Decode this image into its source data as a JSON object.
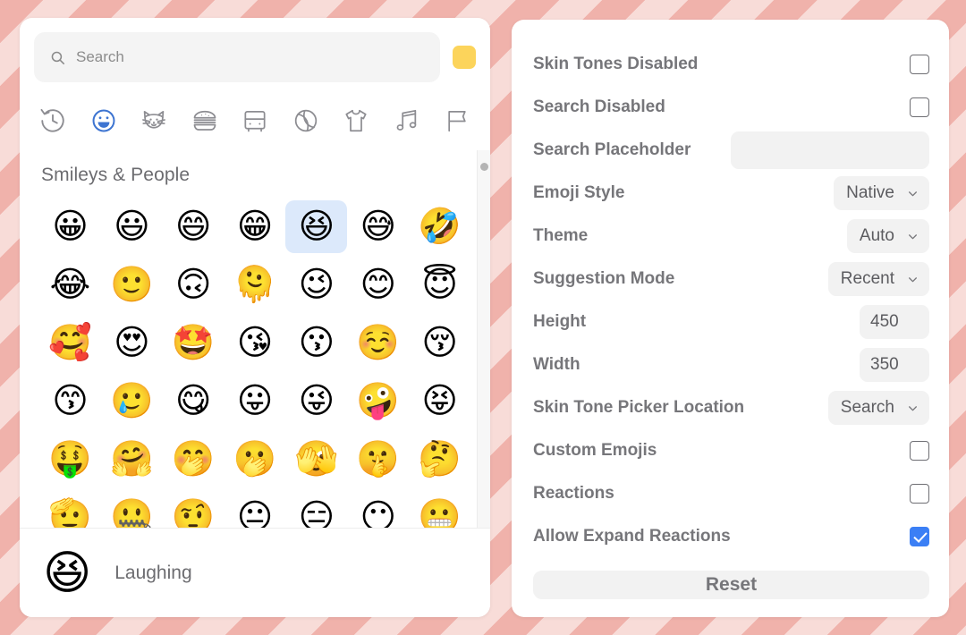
{
  "picker": {
    "search": {
      "placeholder": "Search",
      "value": "",
      "icon": "search-icon"
    },
    "skin_tone_swatch": {
      "color": "#fcd45b",
      "name": "skin-tone-swatch"
    },
    "categories": [
      {
        "id": "recent",
        "label": "Recently Used",
        "icon": "clock-icon",
        "active": false
      },
      {
        "id": "smileys",
        "label": "Smileys & People",
        "icon": "smiley-icon",
        "active": true
      },
      {
        "id": "animals",
        "label": "Animals & Nature",
        "icon": "cat-icon",
        "active": false
      },
      {
        "id": "food",
        "label": "Food & Drink",
        "icon": "burger-icon",
        "active": false
      },
      {
        "id": "travel",
        "label": "Travel & Places",
        "icon": "bus-icon",
        "active": false
      },
      {
        "id": "activities",
        "label": "Activities",
        "icon": "ball-icon",
        "active": false
      },
      {
        "id": "objects",
        "label": "Objects",
        "icon": "shirt-icon",
        "active": false
      },
      {
        "id": "symbols",
        "label": "Symbols",
        "icon": "music-note-icon",
        "active": false
      },
      {
        "id": "flags",
        "label": "Flags",
        "icon": "flag-icon",
        "active": false
      }
    ],
    "group_title": "Smileys & People",
    "emoji_rows": [
      [
        "😀",
        "😃",
        "😄",
        "😁",
        "😆",
        "😅",
        "🤣"
      ],
      [
        "😂",
        "🙂",
        "🙃",
        "🫠",
        "😉",
        "😊",
        "😇"
      ],
      [
        "🥰",
        "😍",
        "🤩",
        "😘",
        "😗",
        "☺️",
        "😚"
      ],
      [
        "😙",
        "🥲",
        "😋",
        "😛",
        "😜",
        "🤪",
        "😝"
      ],
      [
        "🤑",
        "🤗",
        "🤭",
        "🫢",
        "🫣",
        "🤫",
        "🤔"
      ],
      [
        "🫡",
        "🤐",
        "🤨",
        "😐",
        "😑",
        "😶",
        "😬"
      ]
    ],
    "selected_index": {
      "row": 0,
      "col": 4
    },
    "preview": {
      "emoji": "😆",
      "label": "Laughing"
    },
    "scrollbar": {
      "name": "emoji-scrollbar"
    }
  },
  "settings": {
    "rows": [
      {
        "id": "skin-tones-disabled",
        "label": "Skin Tones Disabled",
        "control": "checkbox",
        "checked": false
      },
      {
        "id": "search-disabled",
        "label": "Search Disabled",
        "control": "checkbox",
        "checked": false
      },
      {
        "id": "search-placeholder",
        "label": "Search Placeholder",
        "control": "text",
        "value": "",
        "placeholder": ""
      },
      {
        "id": "emoji-style",
        "label": "Emoji Style",
        "control": "select",
        "value": "Native"
      },
      {
        "id": "theme",
        "label": "Theme",
        "control": "select",
        "value": "Auto"
      },
      {
        "id": "suggestion-mode",
        "label": "Suggestion Mode",
        "control": "select",
        "value": "Recent"
      },
      {
        "id": "height",
        "label": "Height",
        "control": "number",
        "value": "450"
      },
      {
        "id": "width",
        "label": "Width",
        "control": "number",
        "value": "350"
      },
      {
        "id": "skin-tone-picker-location",
        "label": "Skin Tone Picker Location",
        "control": "select",
        "value": "Search"
      },
      {
        "id": "custom-emojis",
        "label": "Custom Emojis",
        "control": "checkbox",
        "checked": false
      },
      {
        "id": "reactions",
        "label": "Reactions",
        "control": "checkbox",
        "checked": false
      },
      {
        "id": "allow-expand-reactions",
        "label": "Allow Expand Reactions",
        "control": "checkbox",
        "checked": true
      }
    ],
    "reset_label": "Reset"
  },
  "colors": {
    "accent_blue": "#3b7ff5",
    "active_tab_blue": "#3d74d1",
    "selected_cell": "#dce9fb",
    "field_gray": "#f2f2f2",
    "stripe_light": "#f8dcd8",
    "stripe_dark": "#f0b2ab"
  }
}
